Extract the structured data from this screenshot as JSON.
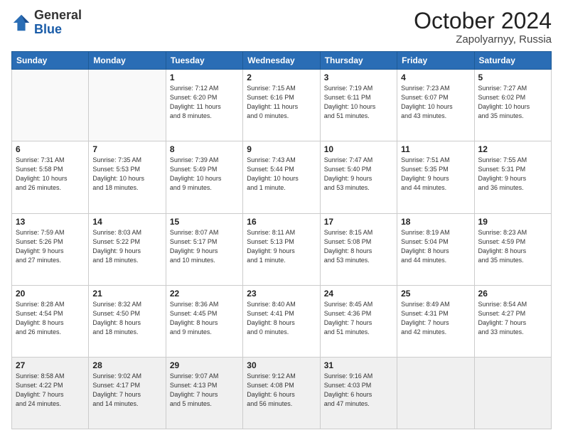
{
  "header": {
    "logo": {
      "general": "General",
      "blue": "Blue"
    },
    "title": "October 2024",
    "location": "Zapolyarnyy, Russia"
  },
  "weekdays": [
    "Sunday",
    "Monday",
    "Tuesday",
    "Wednesday",
    "Thursday",
    "Friday",
    "Saturday"
  ],
  "weeks": [
    [
      {
        "day": "",
        "info": ""
      },
      {
        "day": "",
        "info": ""
      },
      {
        "day": "1",
        "info": "Sunrise: 7:12 AM\nSunset: 6:20 PM\nDaylight: 11 hours\nand 8 minutes."
      },
      {
        "day": "2",
        "info": "Sunrise: 7:15 AM\nSunset: 6:16 PM\nDaylight: 11 hours\nand 0 minutes."
      },
      {
        "day": "3",
        "info": "Sunrise: 7:19 AM\nSunset: 6:11 PM\nDaylight: 10 hours\nand 51 minutes."
      },
      {
        "day": "4",
        "info": "Sunrise: 7:23 AM\nSunset: 6:07 PM\nDaylight: 10 hours\nand 43 minutes."
      },
      {
        "day": "5",
        "info": "Sunrise: 7:27 AM\nSunset: 6:02 PM\nDaylight: 10 hours\nand 35 minutes."
      }
    ],
    [
      {
        "day": "6",
        "info": "Sunrise: 7:31 AM\nSunset: 5:58 PM\nDaylight: 10 hours\nand 26 minutes."
      },
      {
        "day": "7",
        "info": "Sunrise: 7:35 AM\nSunset: 5:53 PM\nDaylight: 10 hours\nand 18 minutes."
      },
      {
        "day": "8",
        "info": "Sunrise: 7:39 AM\nSunset: 5:49 PM\nDaylight: 10 hours\nand 9 minutes."
      },
      {
        "day": "9",
        "info": "Sunrise: 7:43 AM\nSunset: 5:44 PM\nDaylight: 10 hours\nand 1 minute."
      },
      {
        "day": "10",
        "info": "Sunrise: 7:47 AM\nSunset: 5:40 PM\nDaylight: 9 hours\nand 53 minutes."
      },
      {
        "day": "11",
        "info": "Sunrise: 7:51 AM\nSunset: 5:35 PM\nDaylight: 9 hours\nand 44 minutes."
      },
      {
        "day": "12",
        "info": "Sunrise: 7:55 AM\nSunset: 5:31 PM\nDaylight: 9 hours\nand 36 minutes."
      }
    ],
    [
      {
        "day": "13",
        "info": "Sunrise: 7:59 AM\nSunset: 5:26 PM\nDaylight: 9 hours\nand 27 minutes."
      },
      {
        "day": "14",
        "info": "Sunrise: 8:03 AM\nSunset: 5:22 PM\nDaylight: 9 hours\nand 18 minutes."
      },
      {
        "day": "15",
        "info": "Sunrise: 8:07 AM\nSunset: 5:17 PM\nDaylight: 9 hours\nand 10 minutes."
      },
      {
        "day": "16",
        "info": "Sunrise: 8:11 AM\nSunset: 5:13 PM\nDaylight: 9 hours\nand 1 minute."
      },
      {
        "day": "17",
        "info": "Sunrise: 8:15 AM\nSunset: 5:08 PM\nDaylight: 8 hours\nand 53 minutes."
      },
      {
        "day": "18",
        "info": "Sunrise: 8:19 AM\nSunset: 5:04 PM\nDaylight: 8 hours\nand 44 minutes."
      },
      {
        "day": "19",
        "info": "Sunrise: 8:23 AM\nSunset: 4:59 PM\nDaylight: 8 hours\nand 35 minutes."
      }
    ],
    [
      {
        "day": "20",
        "info": "Sunrise: 8:28 AM\nSunset: 4:54 PM\nDaylight: 8 hours\nand 26 minutes."
      },
      {
        "day": "21",
        "info": "Sunrise: 8:32 AM\nSunset: 4:50 PM\nDaylight: 8 hours\nand 18 minutes."
      },
      {
        "day": "22",
        "info": "Sunrise: 8:36 AM\nSunset: 4:45 PM\nDaylight: 8 hours\nand 9 minutes."
      },
      {
        "day": "23",
        "info": "Sunrise: 8:40 AM\nSunset: 4:41 PM\nDaylight: 8 hours\nand 0 minutes."
      },
      {
        "day": "24",
        "info": "Sunrise: 8:45 AM\nSunset: 4:36 PM\nDaylight: 7 hours\nand 51 minutes."
      },
      {
        "day": "25",
        "info": "Sunrise: 8:49 AM\nSunset: 4:31 PM\nDaylight: 7 hours\nand 42 minutes."
      },
      {
        "day": "26",
        "info": "Sunrise: 8:54 AM\nSunset: 4:27 PM\nDaylight: 7 hours\nand 33 minutes."
      }
    ],
    [
      {
        "day": "27",
        "info": "Sunrise: 8:58 AM\nSunset: 4:22 PM\nDaylight: 7 hours\nand 24 minutes."
      },
      {
        "day": "28",
        "info": "Sunrise: 9:02 AM\nSunset: 4:17 PM\nDaylight: 7 hours\nand 14 minutes."
      },
      {
        "day": "29",
        "info": "Sunrise: 9:07 AM\nSunset: 4:13 PM\nDaylight: 7 hours\nand 5 minutes."
      },
      {
        "day": "30",
        "info": "Sunrise: 9:12 AM\nSunset: 4:08 PM\nDaylight: 6 hours\nand 56 minutes."
      },
      {
        "day": "31",
        "info": "Sunrise: 9:16 AM\nSunset: 4:03 PM\nDaylight: 6 hours\nand 47 minutes."
      },
      {
        "day": "",
        "info": ""
      },
      {
        "day": "",
        "info": ""
      }
    ]
  ]
}
